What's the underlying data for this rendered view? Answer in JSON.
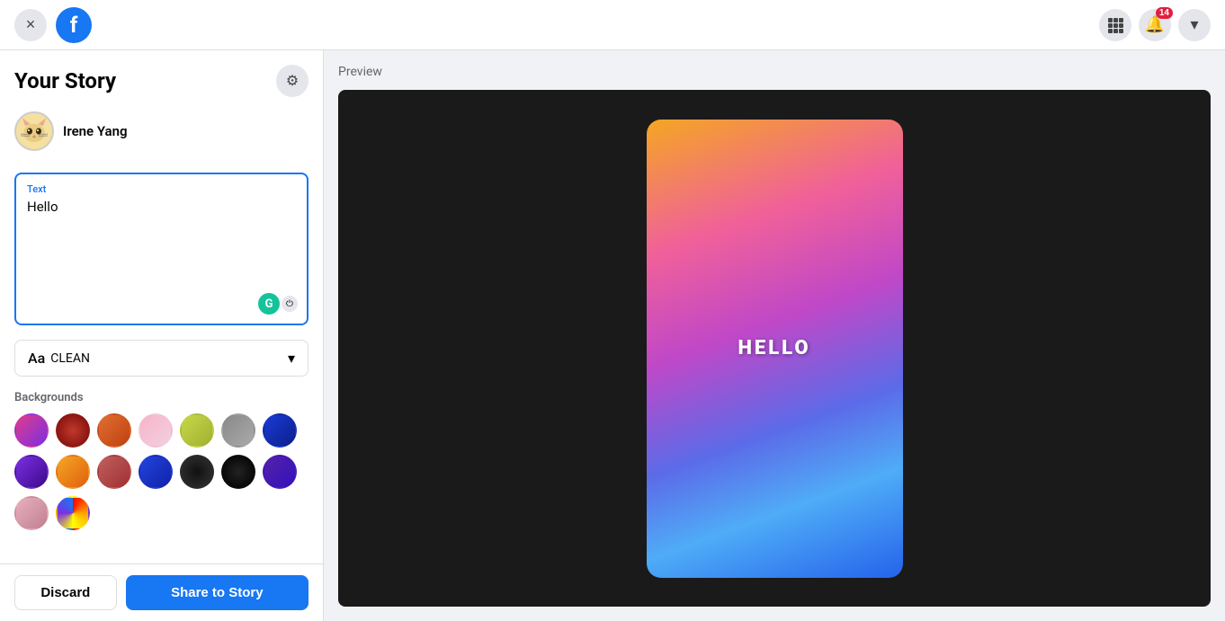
{
  "topbar": {
    "close_label": "×",
    "fb_logo": "f",
    "notification_count": "14",
    "grid_icon": "⠿",
    "bell_icon": "🔔",
    "chevron_icon": "▾"
  },
  "left_panel": {
    "title": "Your Story",
    "settings_icon": "⚙",
    "user": {
      "name": "Irene Yang",
      "avatar_emoji": "🐱"
    },
    "text_input": {
      "label": "Text",
      "value": "Hello",
      "placeholder": ""
    },
    "font_selector": {
      "aa_label": "Aa",
      "font_name": "CLEAN",
      "chevron": "▾"
    },
    "backgrounds": {
      "label": "Backgrounds",
      "swatches": [
        {
          "id": "bg1",
          "gradient": "linear-gradient(135deg, #e03c8a, #7b2fe3)"
        },
        {
          "id": "bg2",
          "gradient": "radial-gradient(circle, #c0392b, #7b0a0a)"
        },
        {
          "id": "bg3",
          "gradient": "linear-gradient(135deg, #e07032, #c04010)"
        },
        {
          "id": "bg4",
          "gradient": "linear-gradient(135deg, #f8b4c8, #f0d0e0)"
        },
        {
          "id": "bg5",
          "gradient": "linear-gradient(135deg, #c8d84a, #a0b030)"
        },
        {
          "id": "bg6",
          "gradient": "linear-gradient(135deg, #888, #aaa)"
        },
        {
          "id": "bg7",
          "gradient": "linear-gradient(135deg, #1a3bd6, #0c1f8a)"
        },
        {
          "id": "bg8",
          "gradient": "linear-gradient(135deg, #7b2fe3, #3d0a8a)"
        },
        {
          "id": "bg9",
          "gradient": "linear-gradient(135deg, #f5a623, #e06010)"
        },
        {
          "id": "bg10",
          "gradient": "linear-gradient(135deg, #c06060, #a03030)"
        },
        {
          "id": "bg11",
          "gradient": "linear-gradient(135deg, #2244dd, #1122aa)"
        },
        {
          "id": "bg12",
          "gradient": "radial-gradient(circle, #111, #333)"
        },
        {
          "id": "bg13",
          "gradient": "radial-gradient(circle, #222, #000)"
        },
        {
          "id": "bg14",
          "gradient": "linear-gradient(135deg, #5522aa, #3311bb)"
        },
        {
          "id": "bg15",
          "gradient": "linear-gradient(135deg, #e8b0c0, #c08090)"
        },
        {
          "id": "bg16",
          "gradient": "conic-gradient(red, orange, yellow, #7b2fe3, #1877f2)"
        }
      ]
    },
    "discard_label": "Discard",
    "share_label": "Share to Story"
  },
  "preview": {
    "label": "Preview",
    "story_text": "HELLO"
  }
}
